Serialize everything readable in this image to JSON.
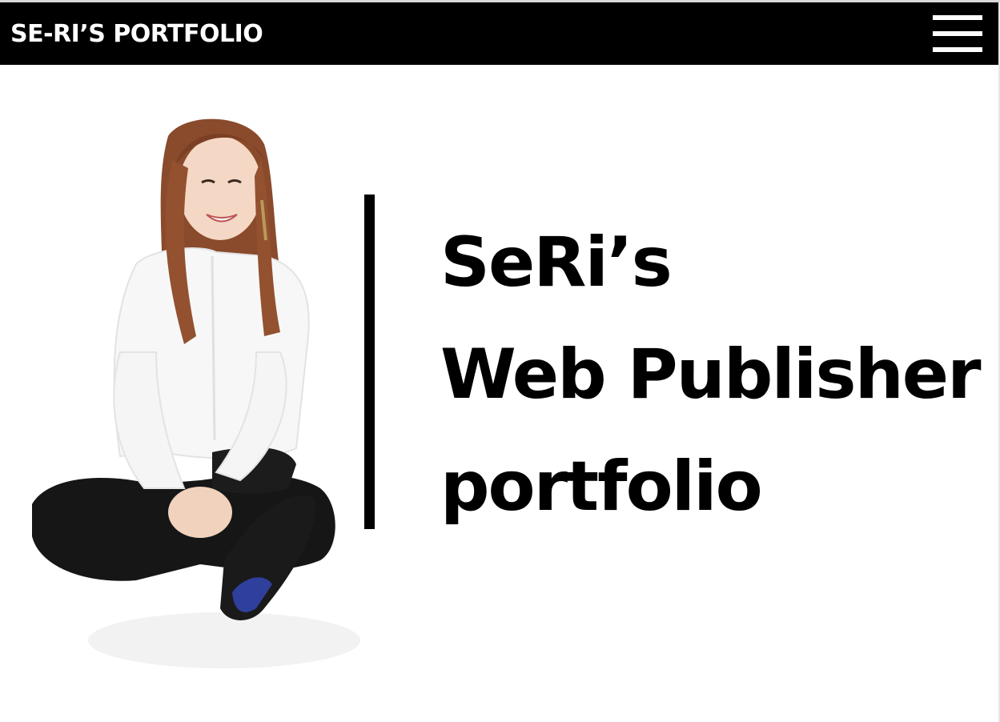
{
  "header": {
    "brand": "SE-RI’S PORTFOLIO",
    "menu_icon": "hamburger-menu-icon"
  },
  "hero": {
    "line1": "SeRi’s",
    "line2": "Web Publisher",
    "line3": "portfolio"
  },
  "colors": {
    "header_bg": "#000000",
    "header_text": "#ffffff",
    "page_bg": "#ffffff",
    "text": "#000000"
  }
}
